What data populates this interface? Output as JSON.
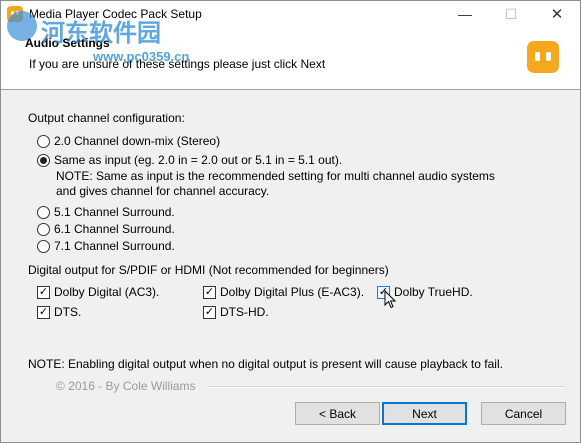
{
  "window": {
    "title": "Media Player Codec Pack Setup",
    "minimize": "—",
    "maximize": "☐",
    "close": "✕"
  },
  "watermark": {
    "text": "河东软件园",
    "url": "www.pc0359.cn"
  },
  "header": {
    "title": "Audio Settings",
    "subtitle": "If you are unsure of these settings please just click Next"
  },
  "output_channel": {
    "label": "Output channel configuration:",
    "options": [
      {
        "label": "2.0 Channel down-mix (Stereo)",
        "selected": false
      },
      {
        "label": "Same as input (eg. 2.0 in = 2.0 out or 5.1 in = 5.1 out).",
        "selected": true
      },
      {
        "label": "5.1 Channel Surround.",
        "selected": false
      },
      {
        "label": "6.1 Channel Surround.",
        "selected": false
      },
      {
        "label": "7.1 Channel Surround.",
        "selected": false
      }
    ],
    "note_line1": "NOTE: Same as input is the recommended setting for multi channel audio systems",
    "note_line2": "and gives channel for channel accuracy."
  },
  "digital_output": {
    "label": "Digital output for S/PDIF or HDMI (Not recommended for beginners)",
    "options": [
      {
        "label": "Dolby Digital (AC3).",
        "checked": true
      },
      {
        "label": "Dolby Digital Plus (E-AC3).",
        "checked": true
      },
      {
        "label": "Dolby TrueHD.",
        "checked": true
      },
      {
        "label": "DTS.",
        "checked": true
      },
      {
        "label": "DTS-HD.",
        "checked": true
      }
    ],
    "check_glyph": "✓"
  },
  "note": "NOTE: Enabling digital output when no digital output is present will cause playback to fail.",
  "copyright": "© 2016 - By Cole Williams",
  "buttons": {
    "back": "< Back",
    "next": "Next",
    "cancel": "Cancel"
  }
}
